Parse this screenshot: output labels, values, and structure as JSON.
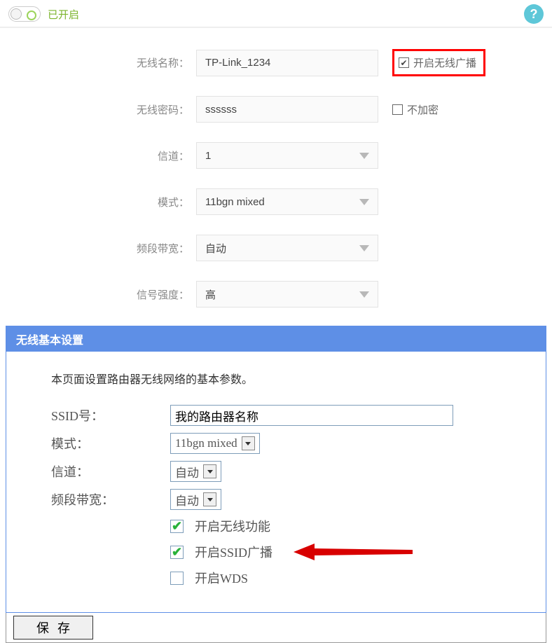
{
  "top": {
    "status": "已开启"
  },
  "form": {
    "labels": {
      "ssid": "无线名称：",
      "pwd": "无线密码：",
      "channel": "信道：",
      "mode": "模式：",
      "bandwidth": "频段带宽：",
      "signal": "信号强度："
    },
    "values": {
      "ssid": "TP-Link_1234",
      "pwd": "ssssss",
      "channel": "1",
      "mode": "11bgn mixed",
      "bandwidth": "自动",
      "signal": "高"
    },
    "checks": {
      "broadcast": "开启无线广播",
      "noenc": "不加密"
    }
  },
  "panel": {
    "title": "无线基本设置",
    "desc": "本页面设置路由器无线网络的基本参数。",
    "labels": {
      "ssid": "SSID号：",
      "mode": "模式：",
      "channel": "信道：",
      "bandwidth": "频段带宽："
    },
    "values": {
      "ssid": "我的路由器名称",
      "mode": "11bgn mixed",
      "channel": "自动",
      "bandwidth": "自动"
    },
    "checks": {
      "wireless": "开启无线功能",
      "ssidbcast": "开启SSID广播",
      "wds": "开启WDS"
    },
    "save": "保存"
  }
}
